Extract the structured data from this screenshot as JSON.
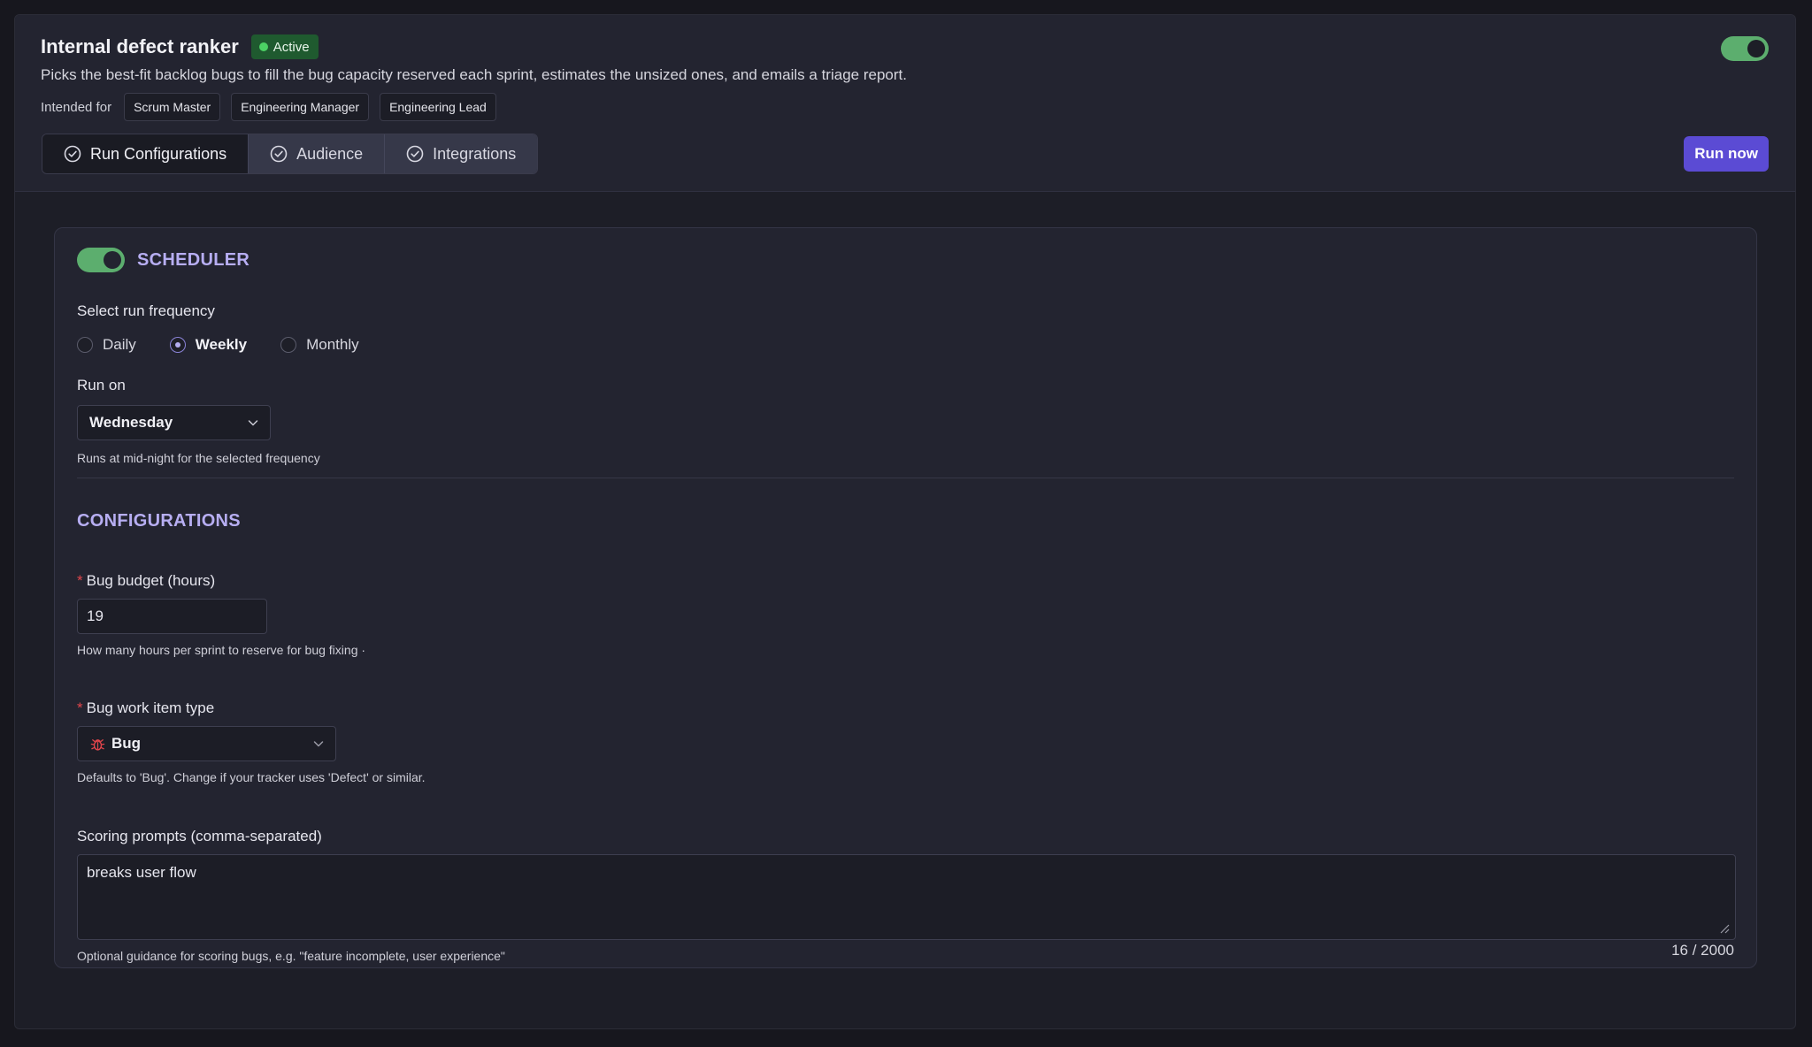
{
  "header": {
    "title": "Internal defect ranker",
    "status_badge": "Active",
    "description": "Picks the best-fit backlog bugs to fill the bug capacity reserved each sprint, estimates the unsized ones, and emails a triage report.",
    "intended_label": "Intended for",
    "audiences": [
      "Scrum Master",
      "Engineering Manager",
      "Engineering Lead"
    ],
    "enabled": true,
    "run_now_label": "Run now"
  },
  "tabs": [
    {
      "label": "Run Configurations",
      "icon": "check-circle-icon",
      "active": true
    },
    {
      "label": "Audience",
      "icon": "check-circle-icon",
      "active": false
    },
    {
      "label": "Integrations",
      "icon": "check-circle-icon",
      "active": false
    }
  ],
  "scheduler": {
    "title": "SCHEDULER",
    "enabled": true,
    "frequency_label": "Select run frequency",
    "frequency_options": [
      "Daily",
      "Weekly",
      "Monthly"
    ],
    "frequency_selected": "Weekly",
    "run_on_label": "Run on",
    "run_on_value": "Wednesday",
    "help": "Runs at mid-night for the selected frequency"
  },
  "configurations": {
    "title": "CONFIGURATIONS",
    "bug_budget": {
      "label": "Bug budget (hours)",
      "required": "*",
      "value": "19",
      "help": "How many hours per sprint to reserve for bug fixing ·"
    },
    "bug_work_item_type": {
      "label": "Bug work item type",
      "required": "*",
      "value": "Bug",
      "icon": "bug-icon",
      "help": "Defaults to 'Bug'. Change if your tracker uses 'Defect' or similar."
    },
    "scoring_prompts": {
      "label": "Scoring prompts (comma-separated)",
      "value": "breaks user flow",
      "counter": "16 / 2000",
      "help": "Optional guidance for scoring bugs, e.g. \"feature incomplete, user experience\""
    }
  },
  "colors": {
    "accent": "#5b4bd4",
    "toggle_on": "#5cae6e",
    "section_title": "#b7aef2",
    "active_badge": "#1f5a2f",
    "required": "#e0454b"
  }
}
